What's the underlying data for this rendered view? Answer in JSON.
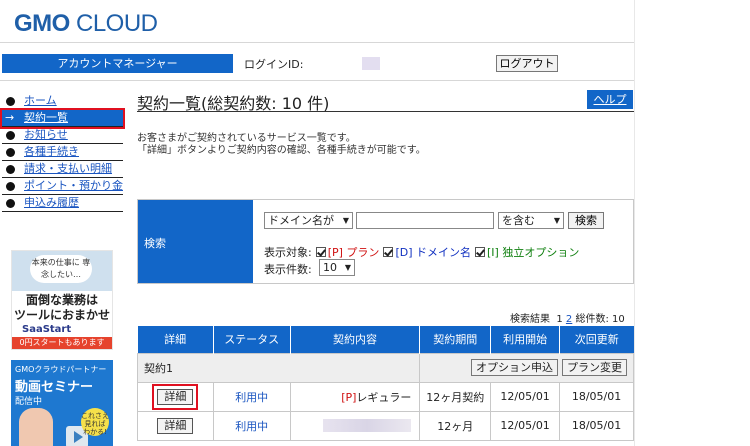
{
  "brand": {
    "logo_bold": "GMO",
    "logo_rest": "CLOUD"
  },
  "header": {
    "account_manager": "アカウントマネージャー",
    "login_label": "ログインID:",
    "logout": "ログアウト"
  },
  "nav": {
    "items": [
      {
        "label": "ホーム"
      },
      {
        "label": "契約一覧",
        "active": true,
        "arrow": "→"
      },
      {
        "label": "お知らせ"
      },
      {
        "label": "各種手続き"
      },
      {
        "label": "請求・支払い明細"
      },
      {
        "label": "ポイント・預かり金"
      },
      {
        "label": "申込み履歴"
      }
    ]
  },
  "ads": {
    "saastart": {
      "bubble": "本来の仕事に 専念したい…",
      "main_l1": "面倒な業務は",
      "main_l2": "ツールにおまかせ",
      "logo": "SaaStart",
      "foot": "0円スタートもあります"
    },
    "seminar": {
      "l1": "GMOクラウドパートナー",
      "l2": "動画セミナー",
      "l3": "配信中",
      "badge": "これさえ 見れば わかる!"
    }
  },
  "main": {
    "title": "契約一覧(総契約数: 10 件)",
    "help": "ヘルプ",
    "desc_l1": "お客さまがご契約されているサービス一覧です。",
    "desc_l2": "「詳細」ボタンよりご契約内容の確認、各種手続きが可能です。"
  },
  "search": {
    "heading": "検索",
    "field_select": "ドメイン名が",
    "match_select": "を含む",
    "search_btn": "検索",
    "target_label": "表示対象:",
    "target_plan": "[P] プラン",
    "target_domain": "[D] ドメイン名",
    "target_option": "[I] 独立オプション",
    "count_label": "表示件数:",
    "count_value": "10"
  },
  "results": {
    "label": "検索結果",
    "page1": "1",
    "page2": "2",
    "total": "総件数: 10"
  },
  "table": {
    "headers": [
      "詳細",
      "ステータス",
      "契約内容",
      "契約期間",
      "利用開始",
      "次回更新"
    ],
    "group": "契約1",
    "option_btn": "オプション申込",
    "plan_change_btn": "プラン変更",
    "rows": [
      {
        "detail": "詳細",
        "status": "利用中",
        "content_tag": "[P]",
        "content": "レギュラー",
        "period": "12ヶ月契約",
        "start": "12/05/01",
        "next": "18/05/01"
      },
      {
        "detail": "詳細",
        "status": "利用中",
        "content_tag": "",
        "content": "",
        "period": "12ヶ月",
        "start": "12/05/01",
        "next": "18/05/01"
      }
    ]
  }
}
